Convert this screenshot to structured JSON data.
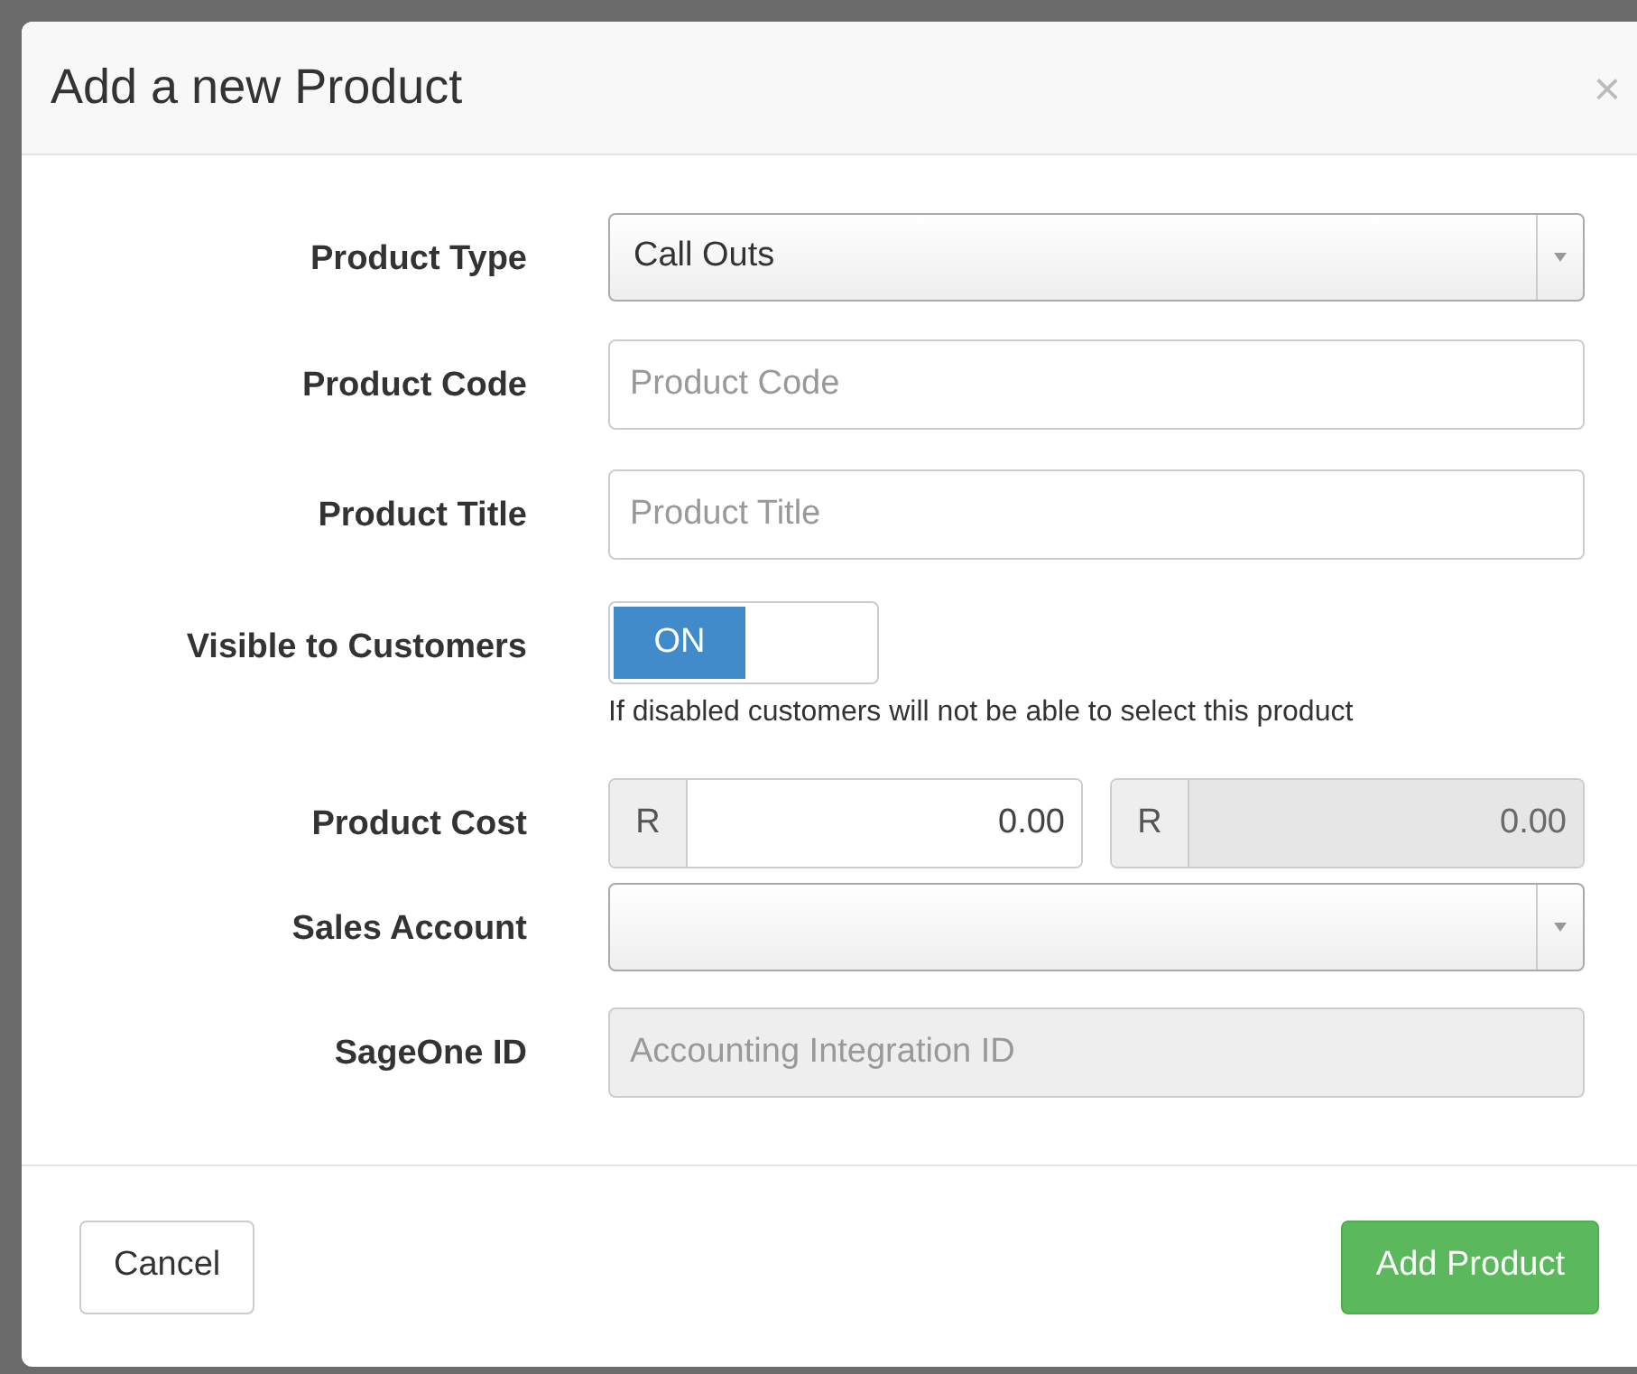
{
  "dialog": {
    "title": "Add a new Product",
    "close": "×"
  },
  "fields": [
    {
      "kind": "select",
      "label": "Product Type",
      "value": "Call Outs"
    },
    {
      "kind": "text",
      "label": "Product Code",
      "placeholder": "Product Code",
      "disabled": false
    },
    {
      "kind": "text",
      "label": "Product Title",
      "placeholder": "Product Title",
      "disabled": false
    },
    {
      "kind": "toggle",
      "label": "Visible to Customers",
      "on": true,
      "on_label": "ON",
      "help": "If disabled customers will not be able to select this product"
    },
    {
      "kind": "currency",
      "label": "Product Cost",
      "inputs": [
        {
          "prefix": "R",
          "value": "0.00",
          "disabled": false
        },
        {
          "prefix": "R",
          "value": "0.00",
          "disabled": true
        }
      ]
    },
    {
      "kind": "select",
      "label": "Sales Account"
    },
    {
      "kind": "text",
      "label": "SageOne ID",
      "placeholder": "Accounting Integration ID",
      "disabled": true
    }
  ],
  "buttons": [
    {
      "kind": "default",
      "label": "Cancel"
    },
    {
      "kind": "primary",
      "label": "Add Product"
    }
  ]
}
